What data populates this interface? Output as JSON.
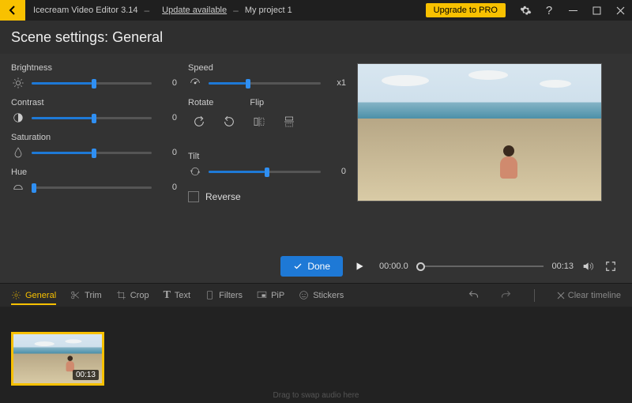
{
  "titlebar": {
    "app": "Icecream Video Editor 3.14",
    "update": "Update available",
    "project": "My project 1",
    "upgrade": "Upgrade to PRO"
  },
  "header": "Scene settings: General",
  "sliders": {
    "brightness": {
      "label": "Brightness",
      "value": "0",
      "pct": 50
    },
    "contrast": {
      "label": "Contrast",
      "value": "0",
      "pct": 50
    },
    "saturation": {
      "label": "Saturation",
      "value": "0",
      "pct": 50
    },
    "hue": {
      "label": "Hue",
      "value": "0",
      "pct": 0
    },
    "speed": {
      "label": "Speed",
      "value": "x1",
      "pct": 33
    },
    "tilt": {
      "label": "Tilt",
      "value": "0",
      "pct": 50
    }
  },
  "labels": {
    "rotate": "Rotate",
    "flip": "Flip",
    "reverse": "Reverse",
    "done": "Done"
  },
  "playback": {
    "current": "00:00.0",
    "total": "00:13"
  },
  "tabs": {
    "general": "General",
    "trim": "Trim",
    "crop": "Crop",
    "text": "Text",
    "filters": "Filters",
    "pip": "PiP",
    "stickers": "Stickers",
    "clear": "Clear timeline"
  },
  "clip": {
    "duration": "00:13"
  },
  "timeline_hint": "Drag to swap audio here"
}
